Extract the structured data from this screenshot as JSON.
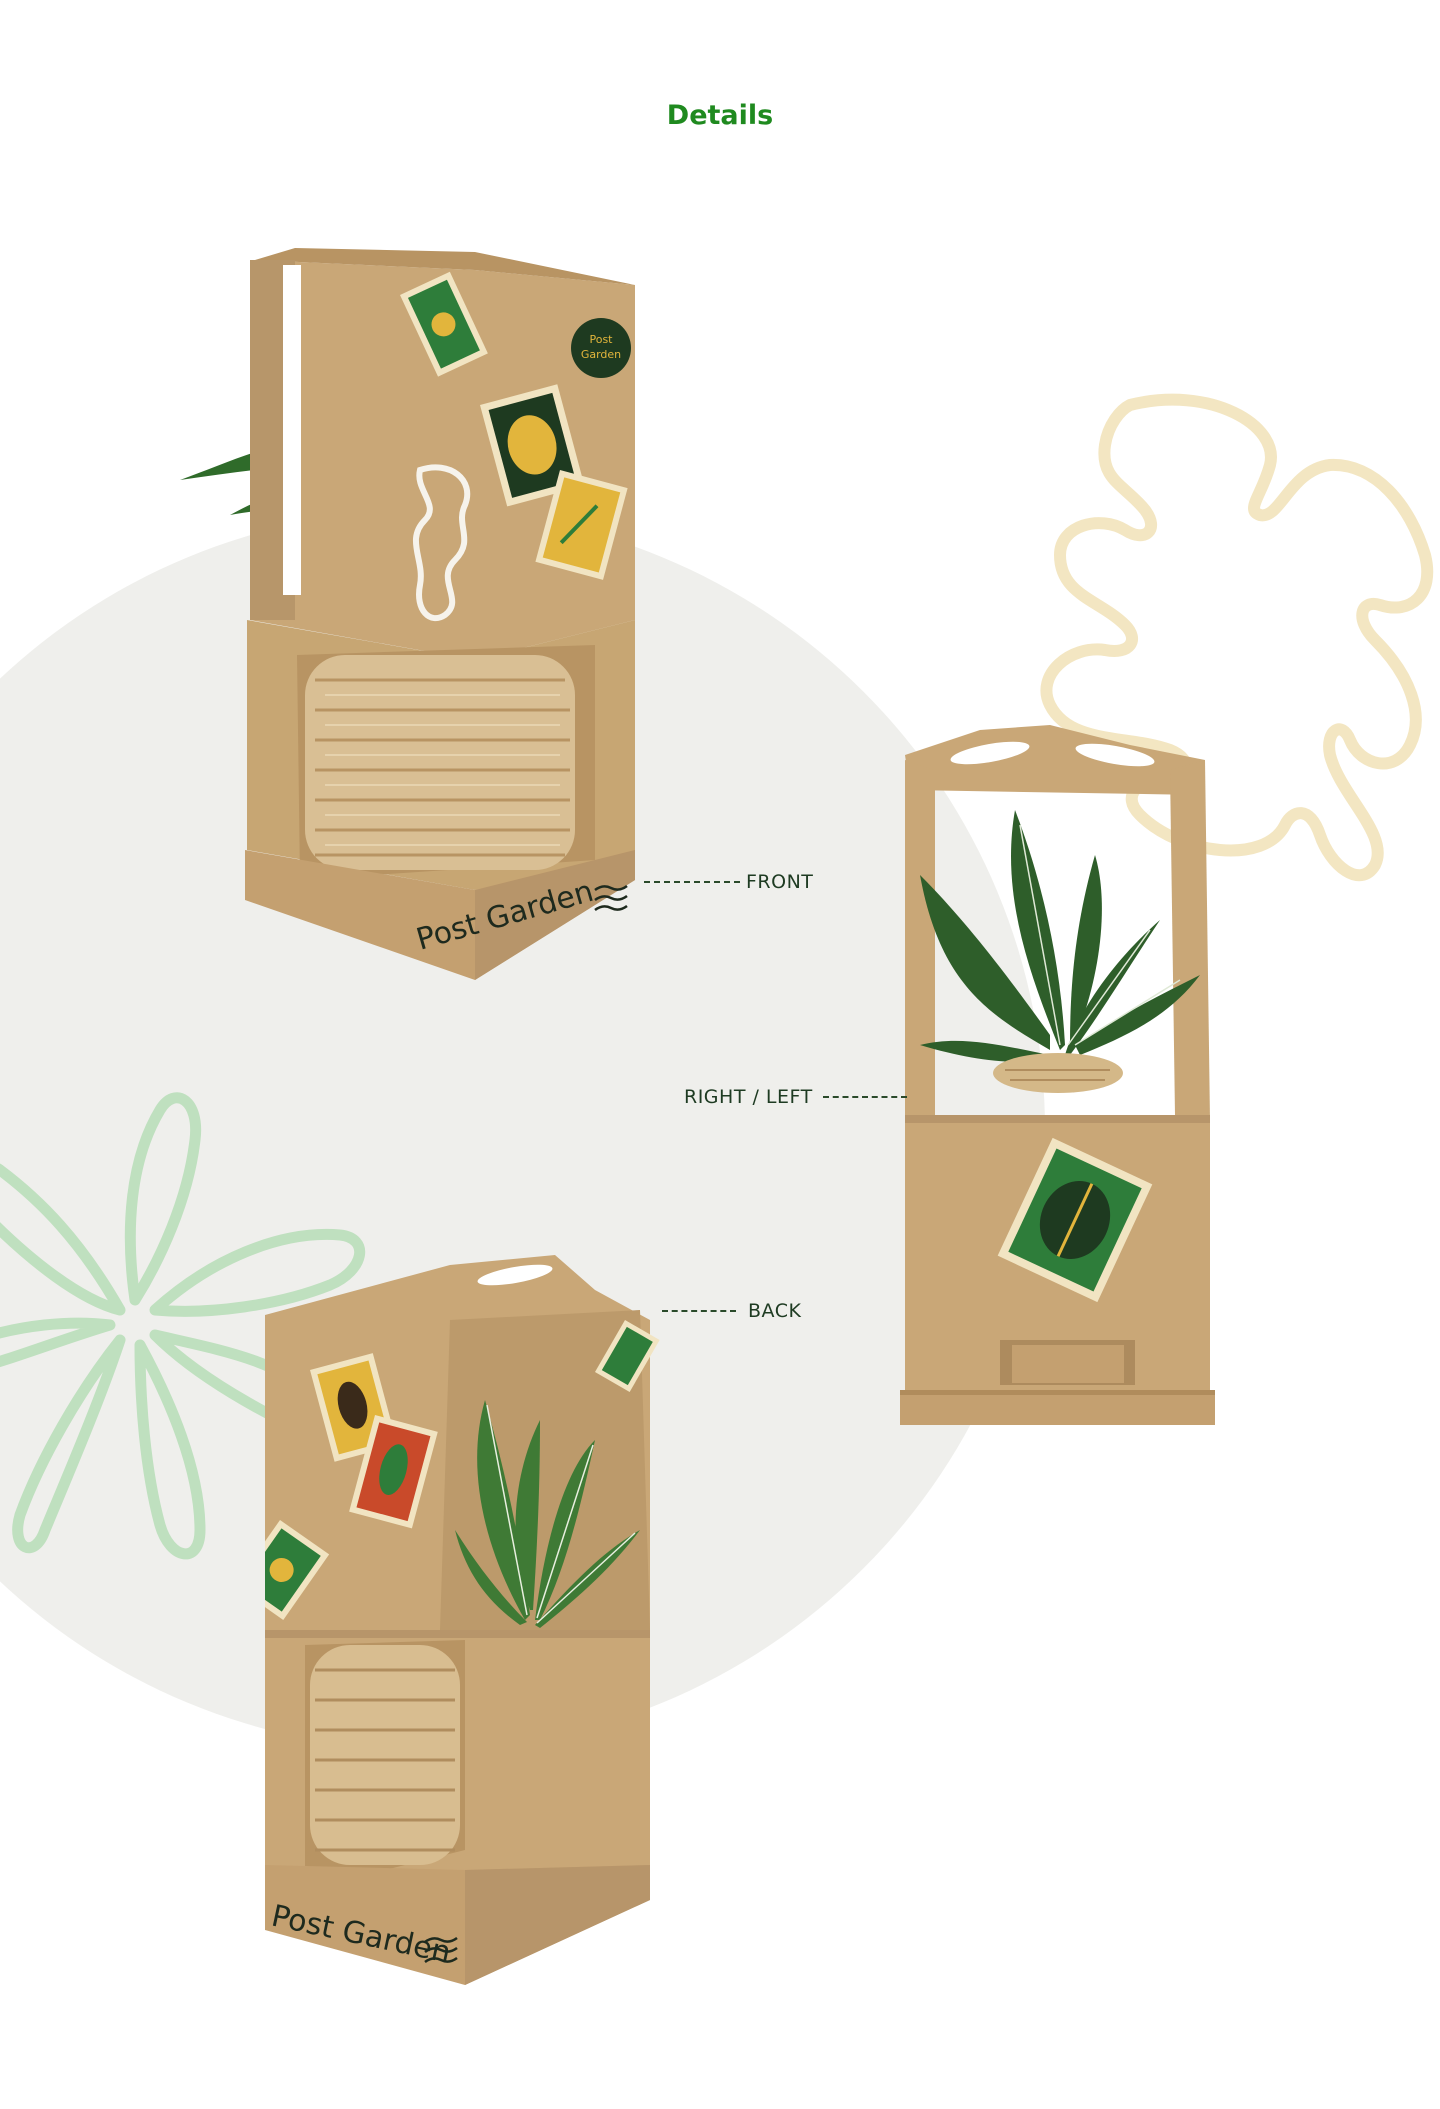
{
  "header": {
    "title": "Details"
  },
  "labels": {
    "front": "FRONT",
    "side": "RIGHT / LEFT",
    "back": "BACK"
  },
  "brand": {
    "wordmark": "Post Garden",
    "badge_line1": "Post",
    "badge_line2": "Garden"
  },
  "colors": {
    "title_green": "#1f8a1f",
    "kraft": "#c9a777",
    "kraft_dark": "#a98a5f",
    "stamp_green": "#2e7d3a",
    "stamp_yellow": "#e2b53c",
    "stamp_red": "#c94a2a",
    "monstera_outline": "#f3e6c2",
    "palm_outline": "#bfe0bf",
    "background_circle": "#efefec"
  }
}
